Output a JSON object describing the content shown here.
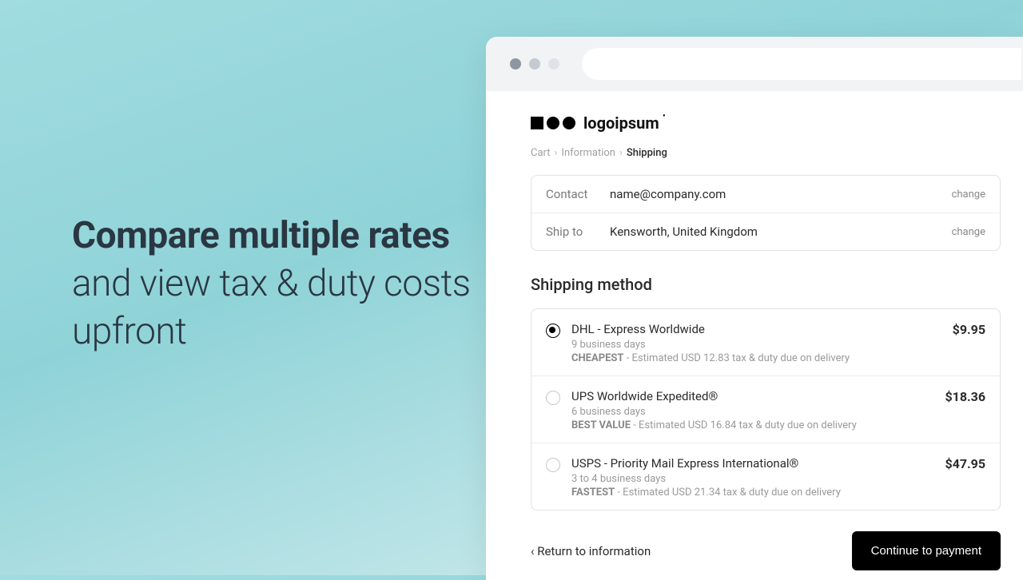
{
  "headline": {
    "bold1": "Compare multiple rates",
    "rest": " and view tax & duty costs upfront"
  },
  "logo": {
    "text": "logoipsum"
  },
  "breadcrumb": {
    "a": "Cart",
    "b": "Information",
    "c": "Shipping"
  },
  "info": {
    "contact_label": "Contact",
    "contact_value": "name@company.com",
    "ship_label": "Ship to",
    "ship_value": "Kensworth, United Kingdom",
    "change": "change"
  },
  "section": {
    "title": "Shipping method"
  },
  "shipping": [
    {
      "name": "DHL - Express Worldwide",
      "time": "9 business days",
      "tag": "CHEAPEST",
      "meta": " - Estimated USD 12.83 tax & duty due on delivery",
      "price": "$9.95",
      "selected": true
    },
    {
      "name": "UPS Worldwide Expedited®",
      "time": "6 business days",
      "tag": "BEST VALUE",
      "meta": " - Estimated USD 16.84 tax & duty due on delivery",
      "price": "$18.36",
      "selected": false
    },
    {
      "name": "USPS - Priority Mail Express International®",
      "time": "3 to 4 business days",
      "tag": "FASTEST",
      "meta": " - Estimated USD 21.34 tax & duty due on delivery",
      "price": "$47.95",
      "selected": false
    }
  ],
  "footer": {
    "return": "Return to information",
    "cta": "Continue to payment"
  }
}
